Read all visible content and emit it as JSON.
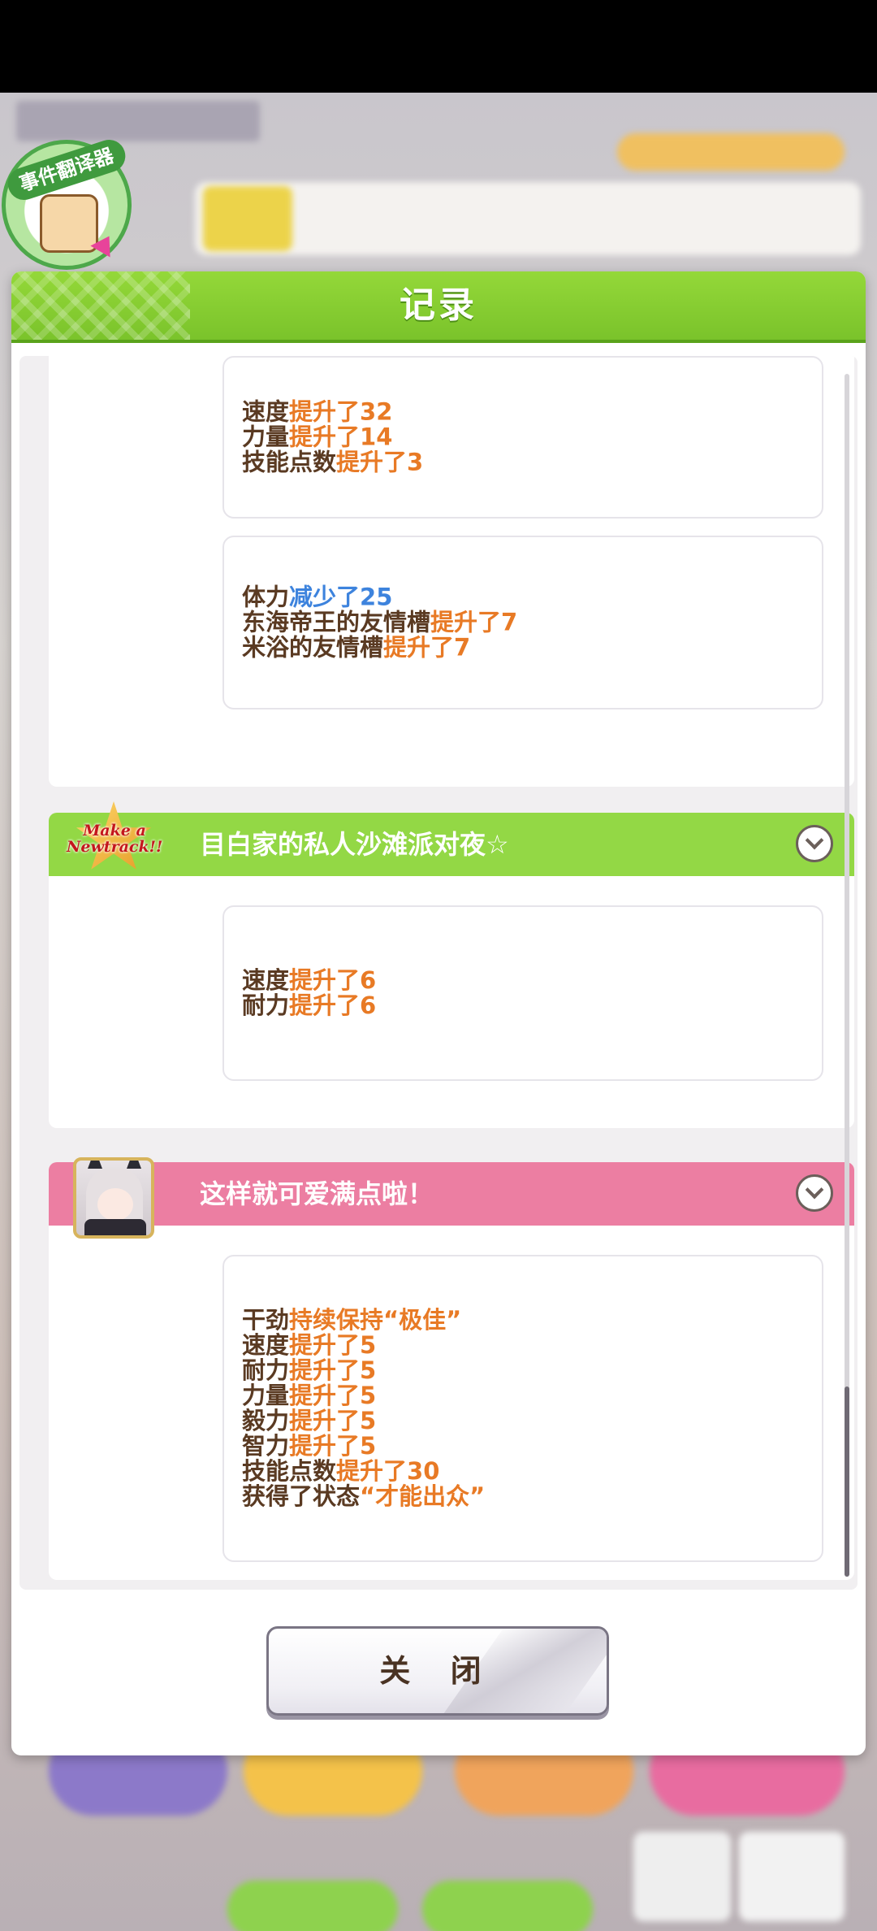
{
  "modal": {
    "title": "记录",
    "close_label": "关 闭"
  },
  "badge": {
    "label": "事件翻译器"
  },
  "record_cards_top": [
    {
      "lines": [
        {
          "stat": "速度",
          "change": "提升了32",
          "dir": "up"
        },
        {
          "stat": "力量",
          "change": "提升了14",
          "dir": "up"
        },
        {
          "stat": "技能点数",
          "change": "提升了3",
          "dir": "up"
        }
      ]
    },
    {
      "lines": [
        {
          "stat": "体力",
          "change": "减少了25",
          "dir": "down"
        },
        {
          "stat": "东海帝王的友情槽",
          "change": "提升了7",
          "dir": "up"
        },
        {
          "stat": "米浴的友情槽",
          "change": "提升了7",
          "dir": "up"
        }
      ]
    }
  ],
  "events": [
    {
      "title": "目白家的私人沙滩派对夜☆",
      "icon_text": "Make a Newtrack!!",
      "color": "#93d845",
      "lines": [
        {
          "stat": "速度",
          "change": "提升了6",
          "dir": "up"
        },
        {
          "stat": "耐力",
          "change": "提升了6",
          "dir": "up"
        }
      ]
    },
    {
      "title": "这样就可爱满点啦！",
      "color": "#ec7ea2",
      "lines": [
        {
          "stat": "干劲",
          "change": "持续保持",
          "quote": "“极佳”",
          "dir": "up"
        },
        {
          "stat": "速度",
          "change": "提升了5",
          "dir": "up"
        },
        {
          "stat": "耐力",
          "change": "提升了5",
          "dir": "up"
        },
        {
          "stat": "力量",
          "change": "提升了5",
          "dir": "up"
        },
        {
          "stat": "毅力",
          "change": "提升了5",
          "dir": "up"
        },
        {
          "stat": "智力",
          "change": "提升了5",
          "dir": "up"
        },
        {
          "stat": "技能点数",
          "change": "提升了30",
          "dir": "up"
        },
        {
          "stat": "获得了状态",
          "quote": "“才能出众”",
          "dir": "up"
        }
      ]
    }
  ],
  "colors": {
    "header_green": "#86cd31",
    "increase_orange": "#e87a25",
    "decrease_blue": "#3d83dd",
    "stat_brown": "#5a3a22"
  }
}
